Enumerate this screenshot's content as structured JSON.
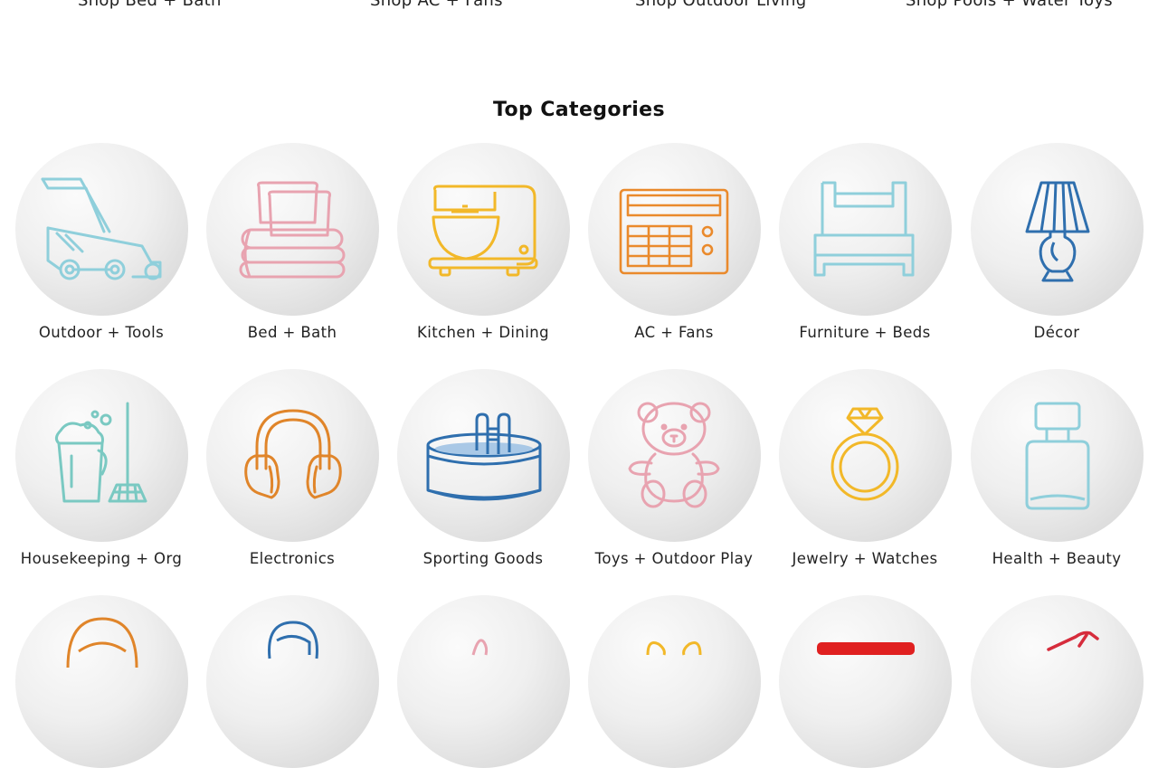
{
  "shop_links": [
    {
      "label": "Shop Bed + Bath"
    },
    {
      "label": "Shop AC + Fans"
    },
    {
      "label": "Shop Outdoor Living"
    },
    {
      "label": "Shop Pools + Water Toys"
    }
  ],
  "section_title": "Top Categories",
  "categories": [
    {
      "label": "Outdoor + Tools",
      "icon": "lawn-mower-icon",
      "color": "#8fcfdb"
    },
    {
      "label": "Bed + Bath",
      "icon": "towels-pillow-icon",
      "color": "#e8a3b0"
    },
    {
      "label": "Kitchen + Dining",
      "icon": "stand-mixer-icon",
      "color": "#f2b829"
    },
    {
      "label": "AC + Fans",
      "icon": "air-conditioner-icon",
      "color": "#ea8a2c"
    },
    {
      "label": "Furniture + Beds",
      "icon": "bed-icon",
      "color": "#8fcfdb"
    },
    {
      "label": "Décor",
      "icon": "table-lamp-icon",
      "color": "#2f6fae"
    },
    {
      "label": "Housekeeping + Org",
      "icon": "bucket-mop-icon",
      "color": "#7ac9c2"
    },
    {
      "label": "Electronics",
      "icon": "headphones-icon",
      "color": "#e0852a"
    },
    {
      "label": "Sporting Goods",
      "icon": "pool-icon",
      "color": "#2f6fae"
    },
    {
      "label": "Toys + Outdoor Play",
      "icon": "teddy-bear-icon",
      "color": "#e8a3b0"
    },
    {
      "label": "Jewelry + Watches",
      "icon": "ring-icon",
      "color": "#f2b829"
    },
    {
      "label": "Health + Beauty",
      "icon": "perfume-bottle-icon",
      "color": "#8fcfdb"
    }
  ],
  "partial_row_icons": [
    {
      "icon": "woman-face-icon",
      "color": "#e0852a"
    },
    {
      "icon": "man-face-icon",
      "color": "#2f6fae"
    },
    {
      "icon": "baby-item-icon",
      "color": "#e8a3b0"
    },
    {
      "icon": "bow-icon",
      "color": "#f2b829"
    },
    {
      "icon": "pet-bed-icon",
      "color": "#e02020"
    },
    {
      "icon": "hammer-icon",
      "color": "#d62c3c"
    }
  ]
}
